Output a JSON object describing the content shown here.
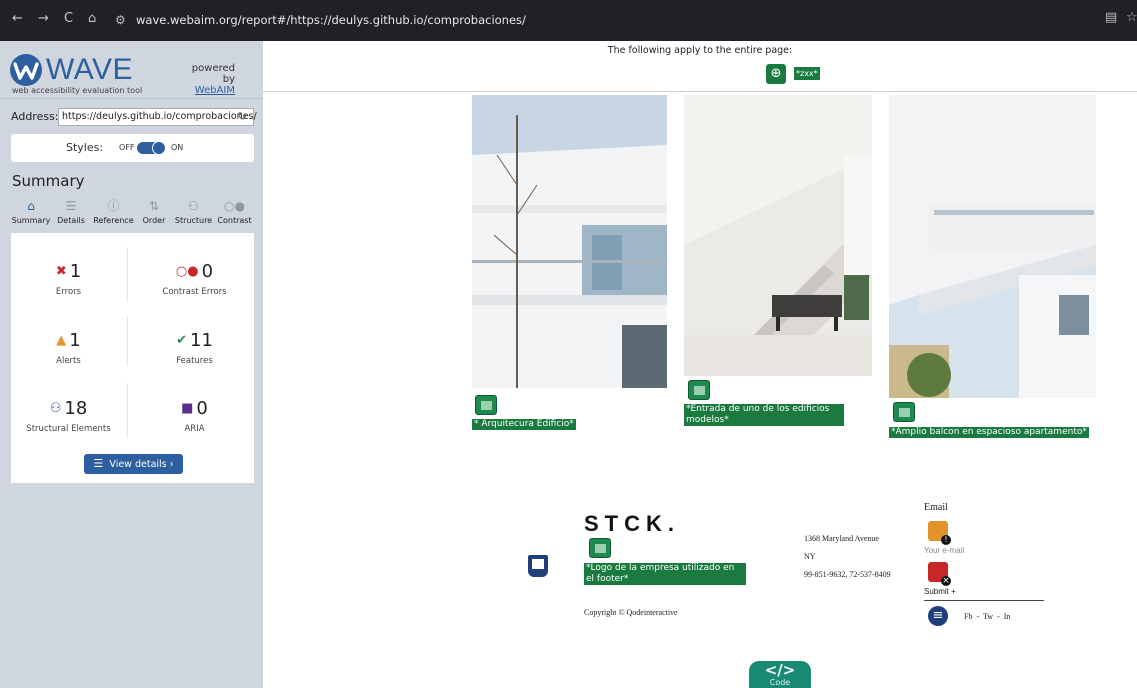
{
  "browser": {
    "url": "wave.webaim.org/report#/https://deulys.github.io/comprobaciones/",
    "nav_back": "←",
    "nav_forward": "→",
    "nav_reload": "C",
    "nav_home": "⌂"
  },
  "sidebar": {
    "logo_text": "WAVE",
    "logo_sub": "web accessibility evaluation tool",
    "powered_by": "powered by",
    "webaim_link": "WebAIM",
    "address_label": "Address:",
    "address_value": "https://deulys.github.io/comprobaciones/",
    "styles_label": "Styles:",
    "styles_off": "OFF",
    "styles_on": "ON",
    "summary_title": "Summary",
    "tabs": [
      {
        "label": "Summary",
        "icon": "home-icon"
      },
      {
        "label": "Details",
        "icon": "list-icon"
      },
      {
        "label": "Reference",
        "icon": "info-icon"
      },
      {
        "label": "Order",
        "icon": "order-icon"
      },
      {
        "label": "Structure",
        "icon": "structure-icon"
      },
      {
        "label": "Contrast",
        "icon": "contrast-icon"
      }
    ],
    "stats": {
      "errors": {
        "count": "1",
        "label": "Errors"
      },
      "contrast_errors": {
        "count": "0",
        "label": "Contrast Errors"
      },
      "alerts": {
        "count": "1",
        "label": "Alerts"
      },
      "features": {
        "count": "11",
        "label": "Features"
      },
      "structural": {
        "count": "18",
        "label": "Structural Elements"
      },
      "aria": {
        "count": "0",
        "label": "ARIA"
      }
    },
    "view_details": "View details ›"
  },
  "page": {
    "note": "The following apply to the entire page:",
    "lang_tag": "*zxx*",
    "alt_1": "* Arquitecura Edificio*",
    "alt_2": "*Entrada de uno de los edificios modelos*",
    "alt_3": "*Amplio balcon en espacioso apartamento*",
    "brand": "STCK.",
    "logo_alt": "*Logo de la empresa utilizado en el footer*",
    "copyright": "Copyright © Qodeinteractive",
    "address_line1": "1368 Maryland Avenue",
    "address_line2": "NY",
    "phone": "99-851-9632, 72-537-8409",
    "email_label": "Email",
    "email_placeholder": "Your e-mail",
    "submit": "Submit +",
    "social": "Fb  -  Tw  -  In",
    "code_label": "Code",
    "code_symbol": "</>"
  },
  "colors": {
    "wave_blue": "#2d5fa0",
    "feature_green": "#1a7a40",
    "sidebar_bg": "#cfd6de"
  }
}
